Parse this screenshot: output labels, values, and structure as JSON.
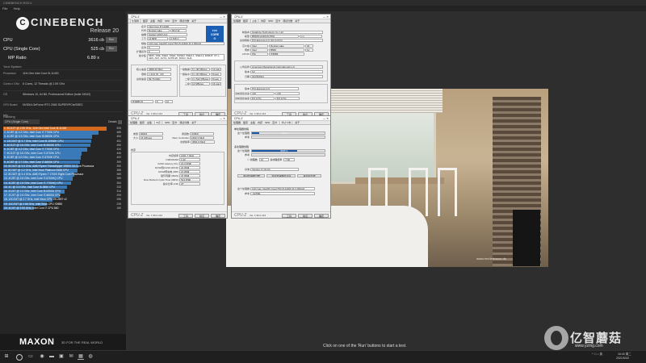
{
  "window": {
    "title": "CINEBENCH R20.0",
    "menu": [
      "File",
      "Help"
    ]
  },
  "logo": {
    "name": "CINEBENCH",
    "release": "Release 20"
  },
  "scores": [
    {
      "label": "CPU",
      "value": "3616 cb",
      "button": "Run"
    },
    {
      "label": "CPU (Single Core)",
      "value": "525 cb",
      "button": "Run"
    },
    {
      "label": "MP Ratio",
      "value": "6.89 x",
      "button": ""
    }
  ],
  "system": {
    "title": "Your System",
    "rows": [
      {
        "k": "Processor",
        "v": "11th Gen Intel Core i5-11400"
      },
      {
        "k": "Cores x GHz",
        "v": "6 Cores, 12 Threads @ 2.59 GHz"
      },
      {
        "k": "OS",
        "v": "Windows 10, 64 Bit, Professional Edition (build 19042)"
      },
      {
        "k": "GFX Board",
        "v": "NVIDIA GeForce RTX 2060 SUPER/PCIe/SSE2"
      },
      {
        "k": "Info",
        "v": ""
      }
    ]
  },
  "ranking": {
    "title": "Ranking",
    "select": "CPU (Single Core)",
    "details": "Details",
    "items": [
      {
        "label": "1. 6C/12T @ 2.59 GHz, 11th Gen Intel Core i5-11400",
        "value": "525",
        "pct": 1.0,
        "color": "#d2691e"
      },
      {
        "label": "2. 4C/8T @ 4.2 GHz, Intel Core i7-7700K CPU",
        "value": "485",
        "pct": 0.92,
        "color": "#3a7ab8"
      },
      {
        "label": "3. 4C/8T @ 3.3 GHz, Intel Core i5-9600K CPU",
        "value": "454",
        "pct": 0.86,
        "color": "#3a7ab8"
      },
      {
        "label": "4. 12C/24T @ 3.7 GHz, Intel Core i9-10900K CPU",
        "value": "451",
        "pct": 0.85,
        "color": "#3a7ab8"
      },
      {
        "label": "5. 6C/12T @ 3.6 GHz, Intel Core i5-9600K CPU",
        "value": "450",
        "pct": 0.84,
        "color": "#3a7ab8"
      },
      {
        "label": "6. 4C/8T @ 4.2 GHz, Intel Core i7-7700K CPU",
        "value": "434",
        "pct": 0.81,
        "color": "#3a7ab8"
      },
      {
        "label": "7. 6C/12T @ 3.6 GHz, Intel Core i7-8700K CPU",
        "value": "406",
        "pct": 0.76,
        "color": "#3a7ab8"
      },
      {
        "label": "8. 4C/8T @ 4.0 GHz, Intel Core i7-6700K CPU",
        "value": "400",
        "pct": 0.75,
        "color": "#3a7ab8"
      },
      {
        "label": "9. 4C/8T @ 3.7 GHz, Intel Core i7-6600K CPU",
        "value": "399",
        "pct": 0.74,
        "color": "#3a7ab8"
      },
      {
        "label": "10. 8C/16T @ 3.6 GHz, AMD Ryzen Threadripper 1950X 16-Core Processor",
        "value": "390",
        "pct": 0.73,
        "color": "#3a7ab8"
      },
      {
        "label": "11. 8C/16T @ 4.2 GHz, Intel Xeon Platinum 8168 CPU",
        "value": "385",
        "pct": 0.72,
        "color": "#3a7ab8"
      },
      {
        "label": "12. 8C/16T @ 3.4 GHz, AMD Ryzen 7 1700X Eight-Core Processor",
        "value": "369",
        "pct": 0.69,
        "color": "#3a7ab8"
      },
      {
        "label": "13. 4C/8T @ 2.6 GHz, Intel Core i7-6700HQ CPU",
        "value": "359",
        "pct": 0.67,
        "color": "#3a7ab8"
      },
      {
        "label": "14. 4C/8T @ 2.8 GHz, Intel Core i7-7700HQ CPU",
        "value": "354",
        "pct": 0.66,
        "color": "#3a7ab8"
      },
      {
        "label": "15. 4C @ 3.3 GHz, Intel Core i5-3550 CPU",
        "value": "333",
        "pct": 0.62,
        "color": "#3a7ab8"
      },
      {
        "label": "16. 2C/4T @ 2.3 GHz, Intel Core i5-5300U CPU",
        "value": "314",
        "pct": 0.59,
        "color": "#3a7ab8"
      },
      {
        "label": "17. 2C/4T @ 2.6 GHz, Intel Core i7-5600U CPU",
        "value": "293",
        "pct": 0.55,
        "color": "#3a7ab8"
      },
      {
        "label": "18. 12C/24T @ 2.7 GHz, Intel Xeon CPU E5-2697 v2",
        "value": "255",
        "pct": 0.48,
        "color": "#3a7ab8"
      },
      {
        "label": "19. 12C/24T @ 2.66 GHz, Intel Xeon CPU X5650",
        "value": "225",
        "pct": 0.42,
        "color": "#3a7ab8"
      },
      {
        "label": "20. 4C/4T @ 2.93 GHz, Intel Core i7 CPU 860",
        "value": "160",
        "pct": 0.3,
        "color": "#3a7ab8"
      }
    ],
    "legend": [
      {
        "label": "Your Score",
        "color": "#d2691e"
      },
      {
        "label": "Identical System",
        "color": "#b8860b"
      }
    ]
  },
  "maxon": {
    "brand": "MAXON",
    "tagline": "3D FOR THE REAL WORLD"
  },
  "render": {
    "watermark": "www.renderbaron.de"
  },
  "status": "Click on one of the 'Run' buttons to start a test.",
  "watermark": {
    "name": "亿智蘑菇",
    "url": "www.yzmg.com"
  },
  "cpuz_common": {
    "brand": "CPU-Z",
    "ver": "Ver. 1.96.0.x64",
    "tools": "工具",
    "verify": "验证",
    "ok": "确定"
  },
  "cpuz1": {
    "title": "CPU-Z",
    "tabs": [
      "处理器",
      "缓存",
      "主板",
      "内存",
      "SPD",
      "显卡",
      "测试分数",
      "关于"
    ],
    "active": 0,
    "rows": [
      {
        "k": "名字",
        "v": "Intel Core i5 11400"
      },
      {
        "k": "代号",
        "v": "Rocket Lake"
      },
      {
        "k": "插槽",
        "v": "Socket 1200 LGA"
      },
      {
        "k": "工艺",
        "v": "14 纳米"
      },
      {
        "k": "规格",
        "v": "11th Gen Intel(R) Core(TM) i5-11400 @ 2.60GHz"
      },
      {
        "k": "系列",
        "v": "6"
      },
      {
        "k": "扩展系列",
        "v": "6"
      },
      {
        "k": "指令集",
        "v": "MMX, SSE, SSE2, SSE3, SSSE3, SSE4.1, SSE4.2, EM64T, VT-x, AES, AVX, AVX2, AVX512F, FMA3, SHA"
      }
    ],
    "tdp": "65.0 W",
    "core_volt": "0.768 V",
    "clocks": [
      {
        "k": "核心速度",
        "v": "4389.26 MHz"
      },
      {
        "k": "倍频",
        "v": "x 44.0 (8 - 44)"
      },
      {
        "k": "总线速度",
        "v": "99.76 MHz"
      }
    ],
    "cache": [
      {
        "k": "一级数据",
        "v": "6 x 48 KBytes",
        "w": "12-way"
      },
      {
        "k": "一级指令",
        "v": "6 x 32 KBytes",
        "w": "8-way"
      },
      {
        "k": "二级",
        "v": "6 x 512 KBytes",
        "w": "8-way"
      },
      {
        "k": "三级",
        "v": "12 MBytes",
        "w": "16-way"
      }
    ],
    "selected": "处理器 #1",
    "cores": "6",
    "threads": "12",
    "intel": [
      "intel",
      "CORE",
      "i5"
    ]
  },
  "cpuz2": {
    "title": "CPU-Z",
    "tabs": [
      "处理器",
      "缓存",
      "主板",
      "内存",
      "SPD",
      "显卡",
      "测试分数",
      "关于"
    ],
    "active": 2,
    "rows": [
      {
        "k": "制造商",
        "v": "Gigabyte Technology Co. Ltd."
      },
      {
        "k": "模型",
        "v": "B560M AORUS PRO",
        "x": "x.x"
      },
      {
        "k": "总线规格",
        "v": "PCI-Express 4.0 (16.0 GT/s)"
      },
      {
        "k": "芯片组",
        "v": "Intel",
        "x": "Rocket Lake",
        "r": "01"
      },
      {
        "k": "南桥",
        "v": "Intel",
        "x": "B560",
        "r": "11"
      },
      {
        "k": "LPCIO",
        "v": "ITE",
        "x": "IT8689"
      }
    ],
    "bios": [
      {
        "k": "公司名称",
        "v": "American Megatrends International LLC."
      },
      {
        "k": "版本",
        "v": "F2"
      },
      {
        "k": "日期",
        "v": "01/25/2021"
      }
    ],
    "gfx": [
      {
        "k": "版本",
        "v": "PCI-Express 3.0"
      },
      {
        "k": "当前连接宽度",
        "v": "x16",
        "x": "x16"
      },
      {
        "k": "当前连接速度",
        "v": "8.0 GT/s",
        "x": "8.0 GT/s"
      }
    ]
  },
  "cpuz3": {
    "title": "CPU-Z",
    "tabs": [
      "处理器",
      "缓存",
      "主板",
      "内存",
      "SPD",
      "显卡",
      "测试分数",
      "关于"
    ],
    "active": 3,
    "rows": [
      {
        "k": "类型",
        "v": "DDR4",
        "x": "通道数",
        "y": "双通道"
      },
      {
        "k": "大小",
        "v": "16 GBytes",
        "x": "Mem Controller",
        "y": "1462.2 MHz"
      },
      {
        "k": "",
        "v": "",
        "x": "北桥频率",
        "y": "3691.9 MHz"
      }
    ],
    "timing_title": "时序",
    "timings": [
      {
        "k": "内存频率",
        "v": "1461.7 MHz"
      },
      {
        "k": "FSB:DRAM",
        "v": "1:22"
      },
      {
        "k": "CAS# Latency (CL)",
        "v": "21.0 时钟"
      },
      {
        "k": "RAS#到CAS# (tRCD)",
        "v": "21 时钟"
      },
      {
        "k": "RAS#预充电 (tRP)",
        "v": "21 时钟"
      },
      {
        "k": "循环周期 (tRAS)",
        "v": "47 时钟"
      },
      {
        "k": "Row Refresh Cycle Time (tRFC)",
        "v": "513 时钟"
      },
      {
        "k": "指令比率 (CR)",
        "v": "2T"
      }
    ]
  },
  "cpuz4": {
    "title": "CPU-Z",
    "tabs": [
      "处理器",
      "缓存",
      "主板",
      "内存",
      "SPD",
      "显卡",
      "测试分数",
      "关于"
    ],
    "active": 6,
    "single_title": "单处理器线程",
    "single": [
      {
        "k": "这个处理器",
        "v": "605.0",
        "pct": 0.1
      },
      {
        "k": "参考",
        "v": "",
        "pct": 0
      }
    ],
    "multi_title": "多处理器线程",
    "multi": [
      {
        "k": "这个处理器",
        "v": "4595.3",
        "pct": 0.62
      },
      {
        "k": "参考",
        "v": "",
        "pct": 0
      }
    ],
    "threads_label": "线程数",
    "threads_value": "12",
    "ratio_label": "多线程倍率",
    "ratio_value": "7.60",
    "bench_label": "基准",
    "bench_value": "Version 17.01.64",
    "b1": "测试处理器分数",
    "b2": "测试处理器稳定度",
    "b3": "提交和比较",
    "this_label": "这个处理器",
    "this_value": "11th Gen Intel(R) Core(TM) i5-11400 @ 2.60GHz",
    "ref_label": "参考",
    "ref_value": "-请选择-"
  },
  "taskbar": {
    "time": "16:40 周二",
    "date": "2021/5/18",
    "lang": "英"
  }
}
